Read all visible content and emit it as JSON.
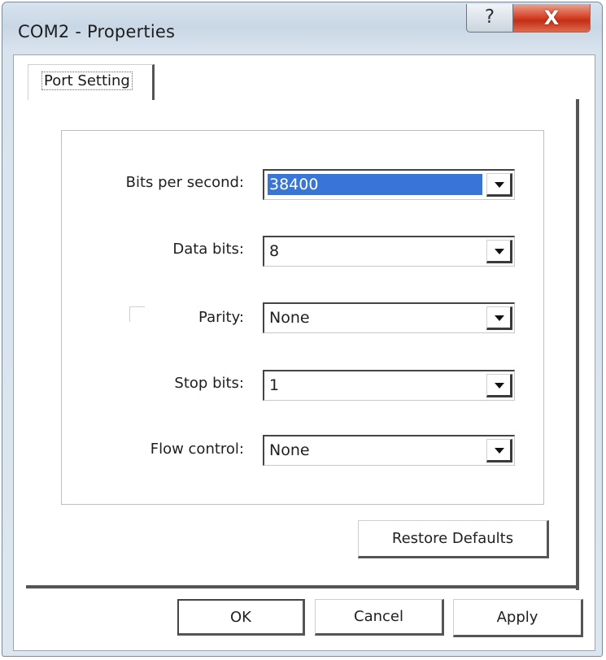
{
  "window": {
    "title": "COM2 - Properties",
    "help_glyph": "?",
    "close_glyph": "X"
  },
  "tabs": [
    {
      "label": "Port Setting"
    }
  ],
  "fields": {
    "bits_per_second": {
      "label": "Bits per second:",
      "value": "38400"
    },
    "data_bits": {
      "label": "Data bits:",
      "value": "8"
    },
    "parity": {
      "label": "Parity:",
      "value": "None"
    },
    "stop_bits": {
      "label": "Stop bits:",
      "value": "1"
    },
    "flow_control": {
      "label": "Flow control:",
      "value": "None"
    }
  },
  "buttons": {
    "restore_defaults": "Restore Defaults",
    "ok": "OK",
    "cancel": "Cancel",
    "apply": "Apply"
  },
  "colors": {
    "selection": "#3875d7",
    "close_button": "#c32f17",
    "title_bar": "#c9d7e5"
  },
  "icons": {
    "help": "help-icon",
    "close": "close-icon",
    "dropdown": "chevron-down-icon"
  }
}
